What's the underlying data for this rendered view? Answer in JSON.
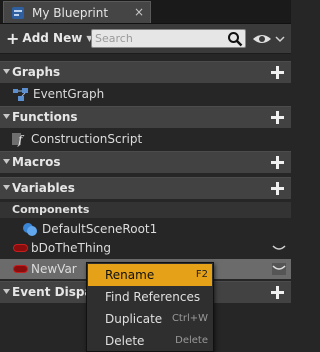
{
  "tab": {
    "title": "My Blueprint",
    "close": "×"
  },
  "toolbar": {
    "add_new_label": "Add New",
    "search_placeholder": "Search"
  },
  "sections": {
    "graphs": {
      "label": "Graphs",
      "items": [
        "EventGraph"
      ]
    },
    "functions": {
      "label": "Functions",
      "items": [
        "ConstructionScript"
      ]
    },
    "macros": {
      "label": "Macros"
    },
    "variables": {
      "label": "Variables"
    },
    "components": {
      "label": "Components",
      "items": [
        "DefaultSceneRoot1"
      ]
    },
    "variable_items": [
      "bDoTheThing",
      "NewVar"
    ],
    "event_dispatchers": {
      "label": "Event Dispat"
    }
  },
  "context_menu": {
    "items": [
      {
        "label": "Rename",
        "shortcut": "F2",
        "highlighted": true
      },
      {
        "label": "Find References",
        "shortcut": ""
      },
      {
        "label": "Duplicate",
        "shortcut": "Ctrl+W"
      },
      {
        "label": "Delete",
        "shortcut": "Delete"
      }
    ]
  },
  "colors": {
    "highlight": "#e5a118",
    "variable_pill": "#8a0d0d",
    "section_header": "#424242",
    "background": "#262626"
  },
  "icons": [
    "blueprint-icon",
    "close-icon",
    "plus-icon",
    "dropdown-caret-icon",
    "search-icon",
    "eye-icon",
    "graph-icon",
    "function-icon",
    "component-icon",
    "variable-pill-icon",
    "chevron-down-icon",
    "add-icon",
    "collapse-arrow-icon"
  ]
}
